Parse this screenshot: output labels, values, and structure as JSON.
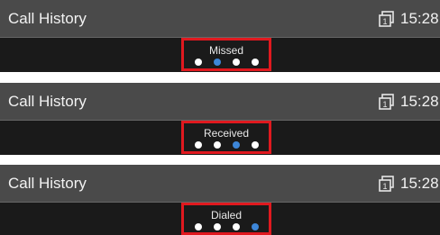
{
  "panels": [
    {
      "title": "Call History",
      "time": "15:28",
      "tab_label": "Missed",
      "dots": 4,
      "active_dot": 1
    },
    {
      "title": "Call History",
      "time": "15:28",
      "tab_label": "Received",
      "dots": 4,
      "active_dot": 2
    },
    {
      "title": "Call History",
      "time": "15:28",
      "tab_label": "Dialed",
      "dots": 4,
      "active_dot": 3
    }
  ],
  "colors": {
    "header_bg": "#4a4a4a",
    "panel_bg": "#1a1a1a",
    "highlight_border": "#e0191f",
    "active_dot": "#3d86d8",
    "inactive_dot": "#ffffff"
  },
  "icons": {
    "line_indicator": "line-1-icon"
  }
}
